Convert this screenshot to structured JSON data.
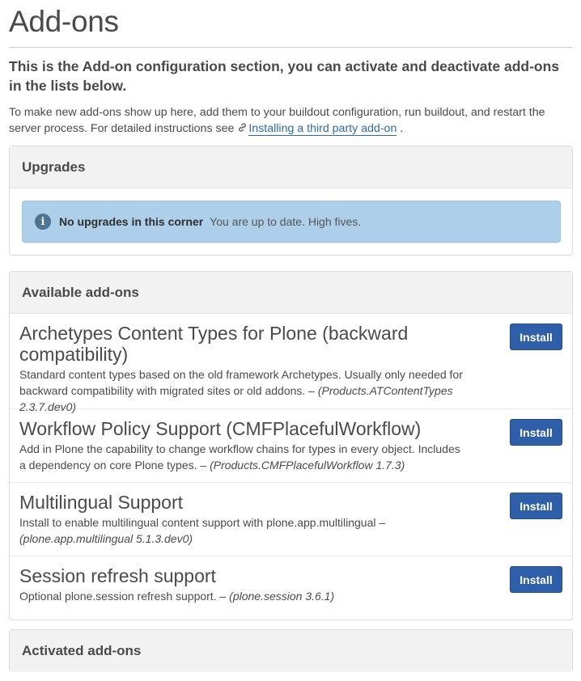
{
  "page": {
    "title": "Add-ons",
    "lead": "This is the Add-on configuration section, you can activate and deactivate add-ons in the lists below.",
    "intro_text": "To make new add-ons show up here, add them to your buildout configuration, run buildout, and restart the server process. For detailed instructions see",
    "intro_link": "Installing a third party add-on",
    "intro_end": "."
  },
  "upgrades": {
    "heading": "Upgrades",
    "alert_title": "No upgrades in this corner",
    "alert_text": "You are up to date. High fives.",
    "icon": "info-icon"
  },
  "available": {
    "heading": "Available add-ons",
    "items": [
      {
        "title": "Archetypes Content Types for Plone (backward compatibility)",
        "description": "Standard content types based on the old framework Archetypes. Usually only needed for backward compatibility with migrated sites or old addons. –",
        "package": "(Products.ATContentTypes 2.3.7.dev0)",
        "button": "Install"
      },
      {
        "title": "Workflow Policy Support (CMFPlacefulWorkflow)",
        "description": "Add in Plone the capability to change workflow chains for types in every object. Includes a dependency on core Plone types. –",
        "package": "(Products.CMFPlacefulWorkflow 1.7.3)",
        "button": "Install"
      },
      {
        "title": "Multilingual Support",
        "description": "Install to enable multilingual content support with plone.app.multilingual –",
        "package": "(plone.app.multilingual 5.1.3.dev0)",
        "button": "Install"
      },
      {
        "title": "Session refresh support",
        "description": "Optional plone.session refresh support. –",
        "package": "(plone.session 3.6.1)",
        "button": "Install"
      }
    ]
  },
  "activated": {
    "heading": "Activated add-ons"
  },
  "colors": {
    "button": "#2f5fa8",
    "alert_bg": "#aecfea",
    "link": "#2e6aa6"
  }
}
